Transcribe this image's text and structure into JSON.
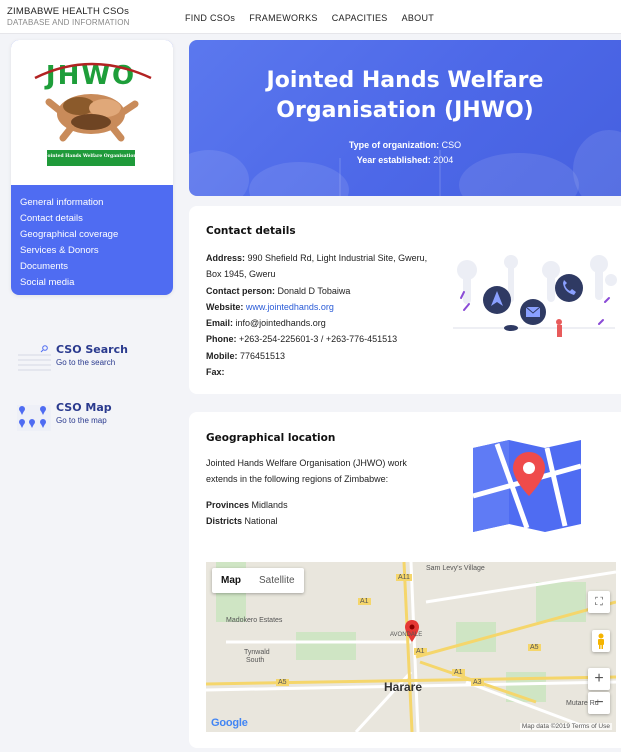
{
  "brand": {
    "title": "ZIMBABWE HEALTH CSOs",
    "subtitle": "DATABASE AND INFORMATION"
  },
  "nav": {
    "items": [
      "FIND CSOs",
      "FRAMEWORKS",
      "CAPACITIES",
      "ABOUT"
    ]
  },
  "sidebar": {
    "logo_text": "JHWO",
    "logo_caption": "Jointed Hands Welfare Organisation",
    "menu": [
      "General information",
      "Contact details",
      "Geographical coverage",
      "Services & Donors",
      "Documents",
      "Social media"
    ],
    "search": {
      "title": "CSO Search",
      "link": "Go to the search"
    },
    "map": {
      "title": "CSO Map",
      "link": "Go to the map"
    }
  },
  "hero": {
    "title_line1": "Jointed Hands Welfare",
    "title_line2": "Organisation (JHWO)",
    "type_label": "Type of organization:",
    "type_value": "CSO",
    "year_label": "Year established:",
    "year_value": "2004"
  },
  "contact": {
    "heading": "Contact details",
    "address_label": "Address:",
    "address_value": "990 Shefield Rd, Light Industrial Site, Gweru,",
    "address_value2": "Box 1945, Gweru",
    "person_label": "Contact person:",
    "person_value": "Donald D Tobaiwa",
    "website_label": "Website:",
    "website_value": "www.jointedhands.org",
    "email_label": "Email:",
    "email_value": "info@jointedhands.org",
    "phone_label": "Phone:",
    "phone_value": "+263-254-225601-3 / +263-776-451513",
    "mobile_label": "Mobile:",
    "mobile_value": "776451513",
    "fax_label": "Fax:",
    "fax_value": ""
  },
  "geo": {
    "heading": "Geographical location",
    "desc1": "Jointed Hands Welfare Organisation (JHWO) work",
    "desc2": "extends in the following regions of Zimbabwe:",
    "provinces_label": "Provinces",
    "provinces_value": "Midlands",
    "districts_label": "Districts",
    "districts_value": "National"
  },
  "map": {
    "tab_map": "Map",
    "tab_satellite": "Satellite",
    "places": [
      "Sam Levy's Village",
      "Madokero Estates",
      "Tynwald",
      "South",
      "AVONDALE",
      "Harare",
      "Mutare Rd"
    ],
    "roads": [
      "A11",
      "A1",
      "A1",
      "A1",
      "A2",
      "A3",
      "A5",
      "A5"
    ],
    "google": "Google",
    "footer": "Map data ©2019   Terms of Use"
  },
  "colors": {
    "accent": "#4f6cf2",
    "link": "#2a5bd7",
    "title": "#2a3a8e"
  }
}
